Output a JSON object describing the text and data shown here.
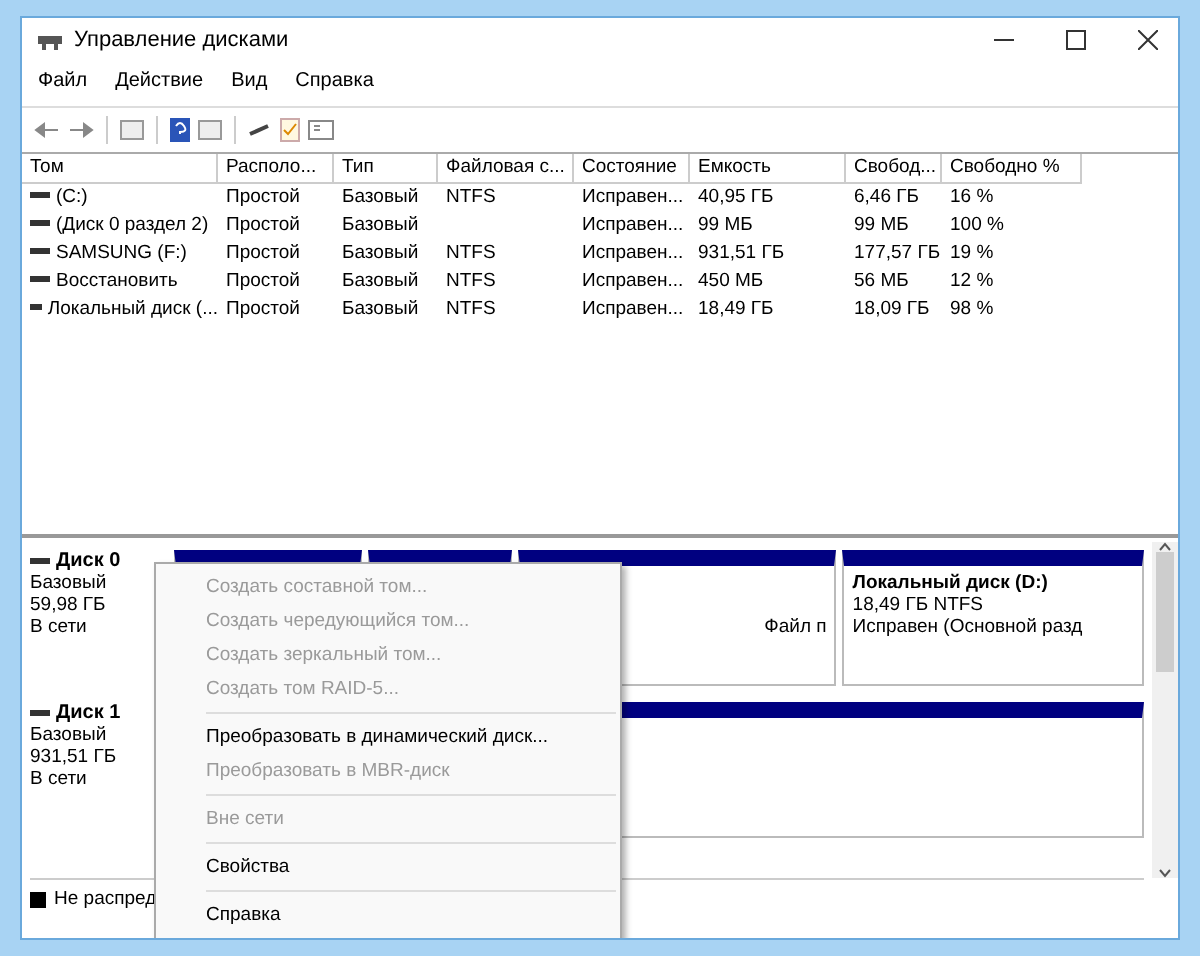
{
  "window": {
    "title": "Управление дисками"
  },
  "menu": [
    "Файл",
    "Действие",
    "Вид",
    "Справка"
  ],
  "table": {
    "columns": [
      "Том",
      "Располо...",
      "Тип",
      "Файловая с...",
      "Состояние",
      "Емкость",
      "Свобод...",
      "Свободно %"
    ],
    "rows": [
      [
        "(C:)",
        "Простой",
        "Базовый",
        "NTFS",
        "Исправен...",
        "40,95 ГБ",
        "6,46 ГБ",
        "16 %"
      ],
      [
        "(Диск 0 раздел 2)",
        "Простой",
        "Базовый",
        "",
        "Исправен...",
        "99 МБ",
        "99 МБ",
        "100 %"
      ],
      [
        "SAMSUNG (F:)",
        "Простой",
        "Базовый",
        "NTFS",
        "Исправен...",
        "931,51 ГБ",
        "177,57 ГБ",
        "19 %"
      ],
      [
        "Восстановить",
        "Простой",
        "Базовый",
        "NTFS",
        "Исправен...",
        "450 МБ",
        "56 МБ",
        "12 %"
      ],
      [
        "Локальный диск (...",
        "Простой",
        "Базовый",
        "NTFS",
        "Исправен...",
        "18,49 ГБ",
        "18,09 ГБ",
        "98 %"
      ]
    ]
  },
  "disks": [
    {
      "name": "Диск 0",
      "type": "Базовый",
      "size": "59,98 ГБ",
      "status": "В сети",
      "partitions": [
        {
          "kind": "covered"
        },
        {
          "kind": "covered"
        },
        {
          "kind": "covered",
          "lines": [
            "Файл п"
          ]
        },
        {
          "kind": "volume",
          "title": "Локальный диск  (D:)",
          "lines": [
            "18,49 ГБ NTFS",
            "Исправен (Основной разд"
          ]
        }
      ]
    },
    {
      "name": "Диск 1",
      "type": "Базовый",
      "size": "931,51 ГБ",
      "status": "В сети",
      "partitions": [
        {
          "kind": "covered"
        }
      ]
    }
  ],
  "legend": [
    {
      "label": "Не распред",
      "color": "#000000"
    }
  ],
  "context_menu": [
    {
      "label": "Создать составной том...",
      "disabled": true,
      "separator_after": false
    },
    {
      "label": "Создать чередующийся том...",
      "disabled": true,
      "separator_after": false
    },
    {
      "label": "Создать зеркальный том...",
      "disabled": true,
      "separator_after": false
    },
    {
      "label": "Создать том RAID-5...",
      "disabled": true,
      "separator_after": true
    },
    {
      "label": "Преобразовать в динамический диск...",
      "disabled": false,
      "separator_after": false
    },
    {
      "label": "Преобразовать в MBR-диск",
      "disabled": true,
      "separator_after": true
    },
    {
      "label": "Вне сети",
      "disabled": true,
      "separator_after": true
    },
    {
      "label": "Свойства",
      "disabled": false,
      "separator_after": true
    },
    {
      "label": "Справка",
      "disabled": false,
      "separator_after": false
    }
  ]
}
